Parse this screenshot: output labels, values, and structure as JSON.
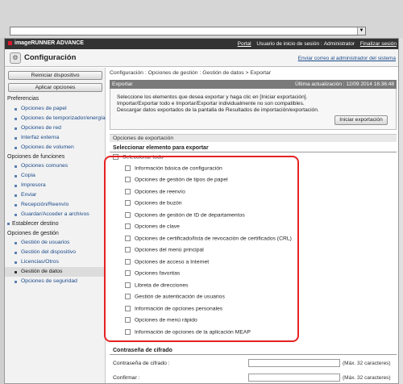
{
  "browser": {
    "address_value": ""
  },
  "topbar": {
    "brand": "imageRUNNER ADVANCE",
    "portal": "Portal",
    "session_prefix": "Usuario de inicio de sesión :",
    "user": "Administrator",
    "logout": "Finalizar sesión"
  },
  "titlebar": {
    "title": "Configuración",
    "mail_admin": "Enviar correo al administrador del sistema"
  },
  "sidebar": {
    "restart_button": "Reiniciar dispositivo",
    "apply_button": "Aplicar opciones",
    "sections": [
      {
        "label": "Preferencias",
        "items": [
          "Opciones de papel",
          "Opciones de temporizador/energía",
          "Opciones de red",
          "Interfaz externa",
          "Opciones de volumen"
        ]
      },
      {
        "label": "Opciones de funciones",
        "items": [
          "Opciones comunes",
          "Copia",
          "Impresora",
          "Enviar",
          "Recepción/Reenvío",
          "Guardar/Acceder a archivos"
        ]
      },
      {
        "label": "Establecer destino",
        "items": []
      },
      {
        "label": "Opciones de gestión",
        "items": [
          "Gestión de usuarios",
          "Gestión del dispositivo",
          "Licencias/Otros",
          "Gestión de datos",
          "Opciones de seguridad"
        ]
      }
    ],
    "selected_item": "Gestión de datos"
  },
  "main": {
    "breadcrumb": "Configuración : Opciones de gestión : Gestión de datos > Exportar",
    "panel_title": "Exportar",
    "last_update": "Última actualización : 12/09 2014 16:36:48",
    "desc_line1": "Seleccione los elementos que desea exportar y haga clic en [Iniciar exportación].",
    "desc_line2": "Importar/Exportar todo e Importar/Exportar individualmente no son compatibles.",
    "desc_line3": "Descargar datos exportados de la pantalla de Resultados de importación/exportación.",
    "start_button": "Iniciar exportación",
    "export_options_title": "Opciones de exportación",
    "select_heading": "Seleccionar elemento para exportar",
    "select_all": "Seleccionar todo",
    "items": [
      "Información básica de configuración",
      "Opciones de gestión de tipos de papel",
      "Opciones de reenvío",
      "Opciones de buzón",
      "Opciones de gestión de ID de departamentos",
      "Opciones de clave",
      "Opciones de certificado/lista de revocación de certificados (CRL)",
      "Opciones del menú principal",
      "Opciones de acceso a Internet",
      "Opciones favoritas",
      "Libreta de direcciones",
      "Gestión de autenticación de usuarios",
      "Información de opciones personales",
      "Opciones de menú rápido",
      "Información de opciones de la aplicación MEAP"
    ],
    "password_title": "Contraseña de cifrado",
    "password_label": "Contraseña de cifrado :",
    "confirm_label": "Confirmar :",
    "max_hint": "(Máx. 32 caracteres)"
  }
}
